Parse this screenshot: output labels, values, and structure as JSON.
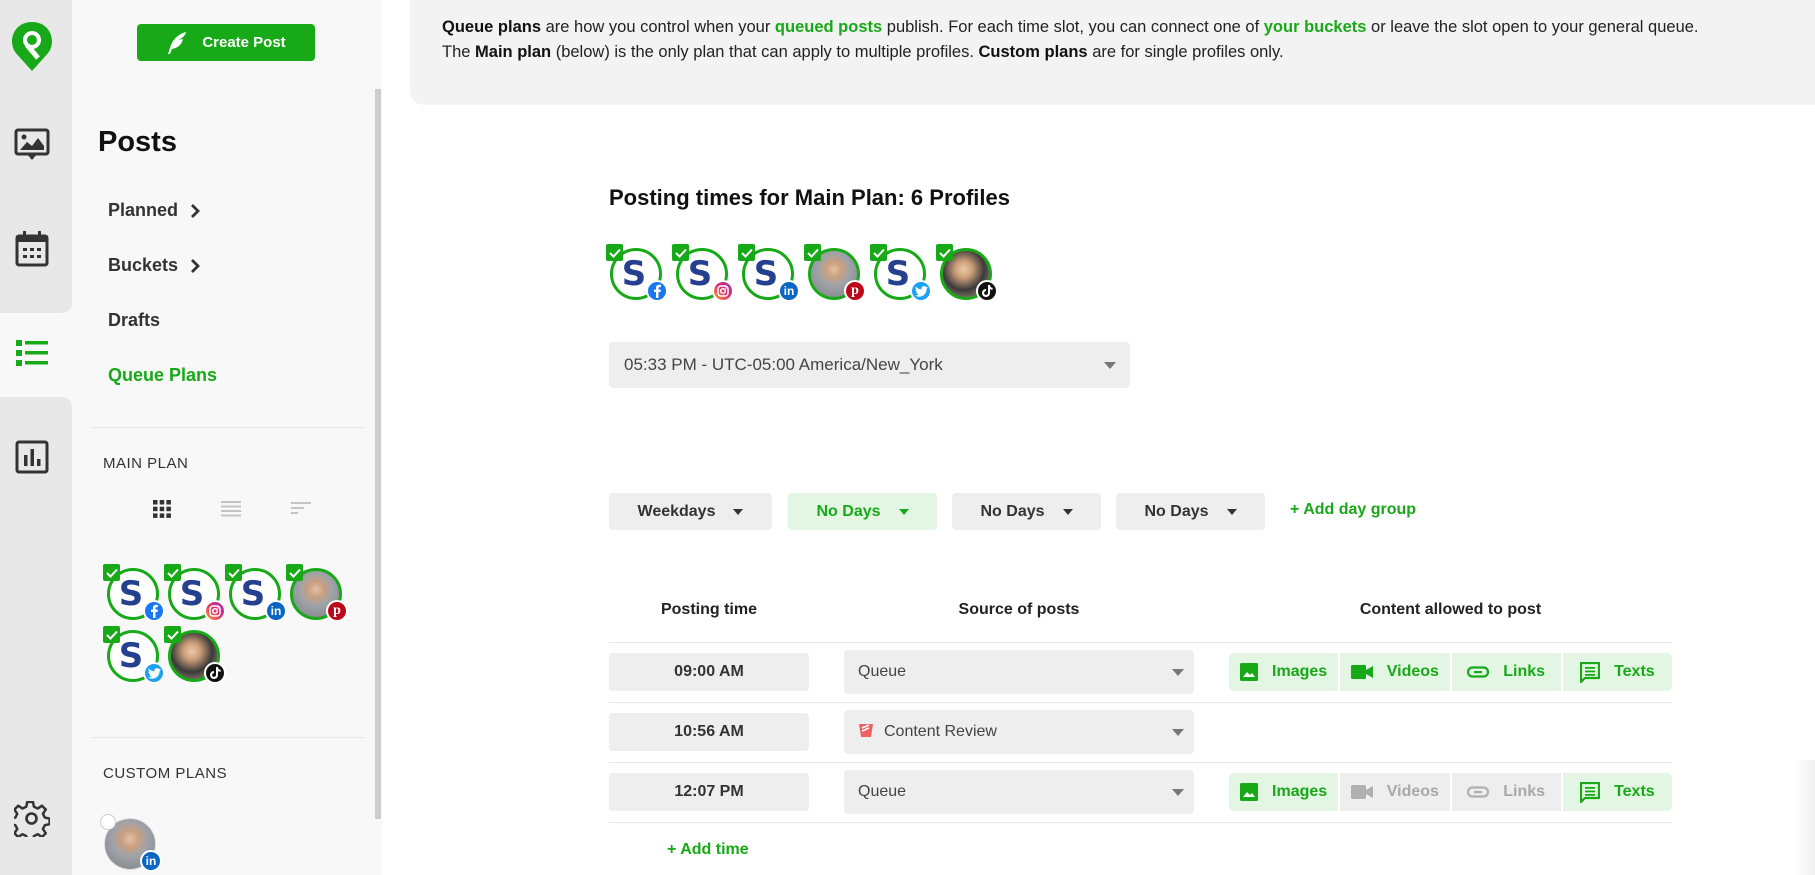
{
  "app": {
    "brand_color": "#17a917"
  },
  "rail": {
    "items": [
      {
        "name": "media-library",
        "icon": "image-chat-icon",
        "active": false
      },
      {
        "name": "calendar",
        "icon": "calendar-icon",
        "active": false
      },
      {
        "name": "posts",
        "icon": "list-icon",
        "active": true
      },
      {
        "name": "analytics",
        "icon": "bar-chart-icon",
        "active": false
      },
      {
        "name": "settings",
        "icon": "gear-icon",
        "active": false
      }
    ]
  },
  "sidebar": {
    "create_post_label": "Create Post",
    "title": "Posts",
    "nav": [
      {
        "label": "Planned",
        "has_chevron": true,
        "active": false
      },
      {
        "label": "Buckets",
        "has_chevron": true,
        "active": false
      },
      {
        "label": "Drafts",
        "has_chevron": false,
        "active": false
      },
      {
        "label": "Queue Plans",
        "has_chevron": false,
        "active": true
      }
    ],
    "main_plan_label": "MAIN PLAN",
    "view_modes": [
      "grid",
      "list",
      "compact"
    ],
    "custom_plans_label": "CUSTOM PLANS",
    "main_plan_profiles": [
      {
        "network": "facebook",
        "type": "brand",
        "checked": true
      },
      {
        "network": "instagram",
        "type": "brand",
        "checked": true
      },
      {
        "network": "linkedin",
        "type": "brand",
        "checked": true
      },
      {
        "network": "pinterest",
        "type": "person",
        "checked": true
      },
      {
        "network": "twitter",
        "type": "brand",
        "checked": true
      },
      {
        "network": "tiktok",
        "type": "person2",
        "checked": true
      }
    ],
    "custom_plan_profiles": [
      {
        "network": "linkedin",
        "type": "person",
        "checked": false
      }
    ]
  },
  "info": {
    "line1_parts": [
      {
        "text": "Queue plans",
        "style": "bold"
      },
      {
        "text": " are how you control when your ",
        "style": "normal"
      },
      {
        "text": "queued posts",
        "style": "green"
      },
      {
        "text": " publish. For each time slot, you can connect one of ",
        "style": "normal"
      },
      {
        "text": "your buckets",
        "style": "green"
      },
      {
        "text": " or leave the slot open to your general queue.",
        "style": "normal"
      }
    ],
    "line2_parts": [
      {
        "text": "The ",
        "style": "normal"
      },
      {
        "text": "Main plan",
        "style": "bold"
      },
      {
        "text": " (below) is the only plan that can apply to multiple profiles. ",
        "style": "normal"
      },
      {
        "text": "Custom plans",
        "style": "bold"
      },
      {
        "text": " are for single profiles only.",
        "style": "normal"
      }
    ]
  },
  "plan": {
    "title_prefix": "Posting times for ",
    "title_name": "Main Plan: 6 Profiles",
    "profiles": [
      {
        "network": "facebook",
        "type": "brand",
        "checked": true
      },
      {
        "network": "instagram",
        "type": "brand",
        "checked": true
      },
      {
        "network": "linkedin",
        "type": "brand",
        "checked": true
      },
      {
        "network": "pinterest",
        "type": "person",
        "checked": true
      },
      {
        "network": "twitter",
        "type": "brand",
        "checked": true
      },
      {
        "network": "tiktok",
        "type": "person2",
        "checked": true
      }
    ],
    "timezone_value": "05:33 PM - UTC-05:00 America/New_York",
    "day_groups": [
      {
        "label": "Weekdays",
        "selected": false
      },
      {
        "label": "No Days",
        "selected": true
      },
      {
        "label": "No Days",
        "selected": false
      },
      {
        "label": "No Days",
        "selected": false
      }
    ],
    "add_day_group_label": "+ Add day group",
    "columns": {
      "time": "Posting time",
      "source": "Source of posts",
      "content": "Content allowed to post"
    },
    "rows": [
      {
        "time": "09:00 AM",
        "source": "Queue",
        "source_icon": null,
        "content": [
          {
            "label": "Images",
            "icon": "image-icon",
            "enabled": true
          },
          {
            "label": "Videos",
            "icon": "video-icon",
            "enabled": true
          },
          {
            "label": "Links",
            "icon": "link-icon",
            "enabled": true
          },
          {
            "label": "Texts",
            "icon": "text-icon",
            "enabled": true
          }
        ]
      },
      {
        "time": "10:56 AM",
        "source": "Content Review",
        "source_icon": "bucket-icon",
        "content": []
      },
      {
        "time": "12:07 PM",
        "source": "Queue",
        "source_icon": null,
        "content": [
          {
            "label": "Images",
            "icon": "image-icon",
            "enabled": true
          },
          {
            "label": "Videos",
            "icon": "video-icon",
            "enabled": false
          },
          {
            "label": "Links",
            "icon": "link-icon",
            "enabled": false
          },
          {
            "label": "Texts",
            "icon": "text-icon",
            "enabled": true
          }
        ]
      }
    ],
    "add_time_label": "+ Add time"
  },
  "network_colors": {
    "facebook": "#1877f2",
    "instagram": "#e1306c",
    "linkedin": "#0a66c2",
    "pinterest": "#bd081c",
    "twitter": "#1da1f2",
    "tiktok": "#111111"
  }
}
